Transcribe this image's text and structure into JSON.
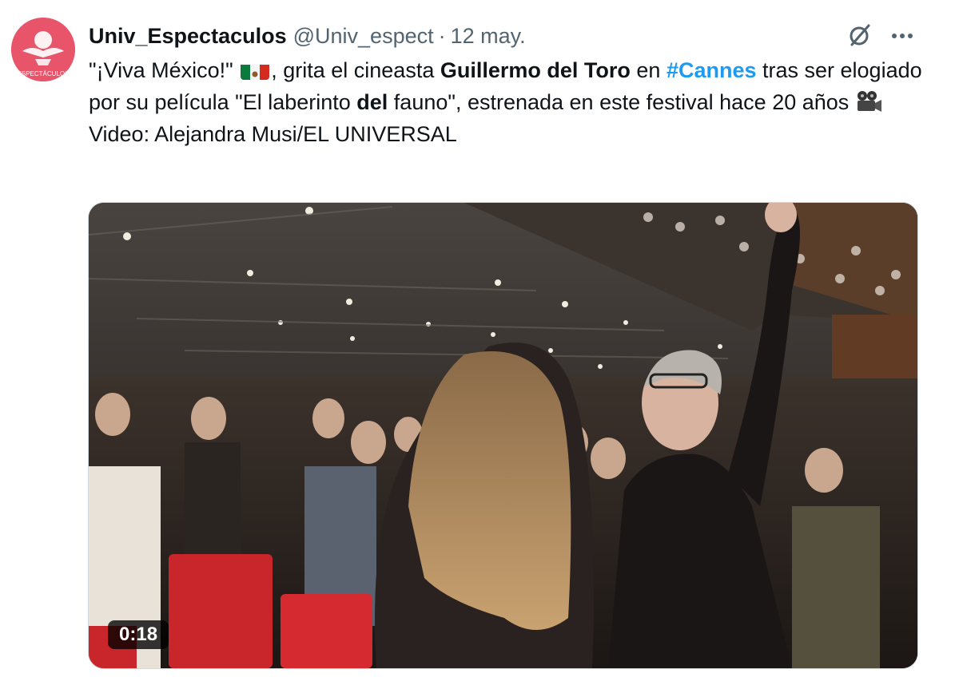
{
  "author": {
    "display_name": "Univ_Espectaculos",
    "handle": "@Univ_espect",
    "separator": "·",
    "date": "12 may.",
    "avatar_icon": "univ-espectaculos-logo-icon",
    "avatar_logo_text": "ESPECTÁCULOS",
    "brand_color": "#e8546a"
  },
  "tweet": {
    "text_1": "\"¡Viva México!\" ",
    "flag_icon": "mexico-flag-icon",
    "text_2": ", grita el cineasta ",
    "bold_1": "Guillermo del Toro",
    "text_3": " en ",
    "hashtag": "#Cannes",
    "text_4": " tras ser elogiado por su película \"El laberinto ",
    "bold_2": "del",
    "text_5": " fauno\", estrenada en este festival hace 20 años ",
    "camera_icon": "movie-camera-icon",
    "credit": "Video: Alejandra Musi/EL UNIVERSAL",
    "hashtag_color": "#1d9bf0"
  },
  "actions": {
    "grok_icon": "grok-icon",
    "more_icon": "more-options-icon"
  },
  "media": {
    "type": "video",
    "duration": "0:18"
  }
}
